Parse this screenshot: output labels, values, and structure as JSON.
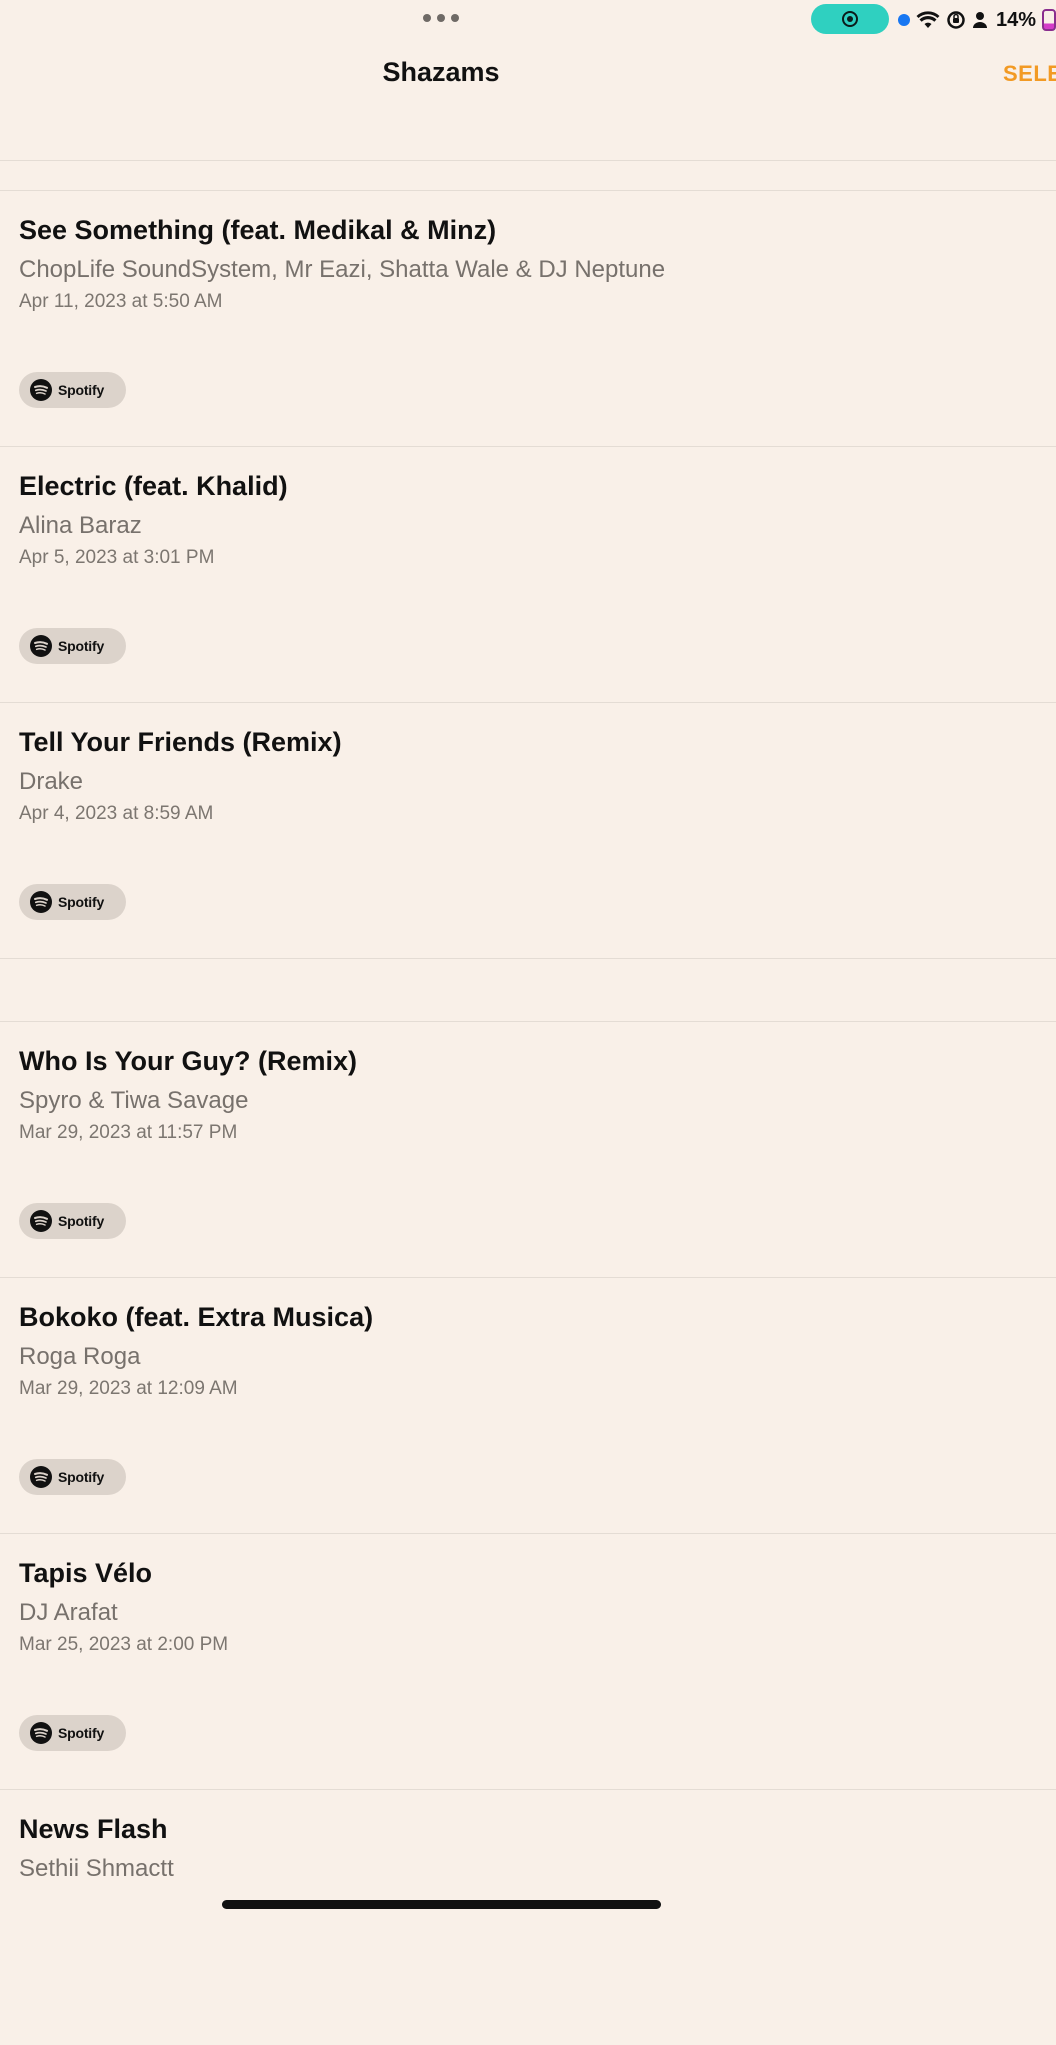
{
  "status_bar": {
    "battery_percent": "14%",
    "icons": [
      "multitasking-dots-icon",
      "screen-recording-icon",
      "location-dot-icon",
      "wifi-icon",
      "orientation-lock-icon",
      "person-icon",
      "battery-icon"
    ],
    "recording_color": "#2fd0c0",
    "battery_level": 0.14
  },
  "header": {
    "title": "Shazams",
    "select_label": "SELE",
    "accent_color": "#f29a24"
  },
  "tracks": [
    {
      "title": "See Something (feat. Medikal & Minz)",
      "artist": "ChopLife SoundSystem, Mr Eazi, Shatta Wale & DJ Neptune",
      "date": "Apr 11, 2023 at 5:50 AM",
      "service_label": "Spotify"
    },
    {
      "title": "Electric (feat. Khalid)",
      "artist": "Alina Baraz",
      "date": "Apr 5, 2023 at 3:01 PM",
      "service_label": "Spotify"
    },
    {
      "title": "Tell Your Friends (Remix)",
      "artist": "Drake",
      "date": "Apr 4, 2023 at 8:59 AM",
      "service_label": "Spotify"
    },
    {
      "title": "Who Is Your Guy? (Remix)",
      "artist": "Spyro & Tiwa Savage",
      "date": "Mar 29, 2023 at 11:57 PM",
      "service_label": "Spotify"
    },
    {
      "title": "Bokoko (feat. Extra Musica)",
      "artist": "Roga Roga",
      "date": "Mar 29, 2023 at 12:09 AM",
      "service_label": "Spotify"
    },
    {
      "title": "Tapis Vélo",
      "artist": "DJ Arafat",
      "date": "Mar 25, 2023 at 2:00 PM",
      "service_label": "Spotify"
    },
    {
      "title": "News Flash",
      "artist": "Sethii Shmactt",
      "date": "",
      "service_label": ""
    }
  ]
}
